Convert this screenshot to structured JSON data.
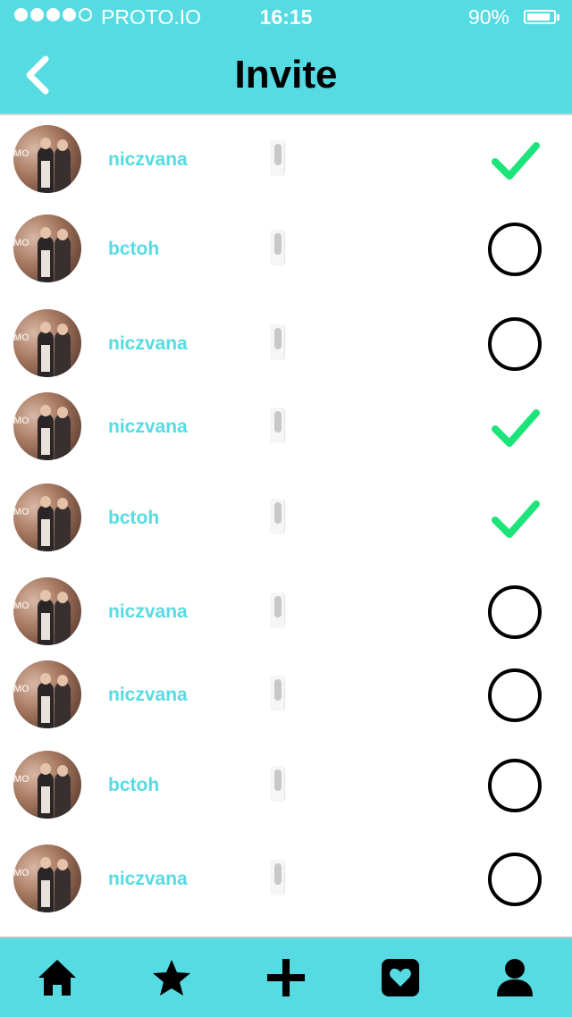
{
  "status_bar": {
    "signal_dots": [
      true,
      true,
      true,
      true,
      false
    ],
    "carrier": "PROTO.IO",
    "time": "16:15",
    "battery": "90%",
    "battery_level": 0.9
  },
  "header": {
    "title": "Invite",
    "back_icon": "chevron-left-icon"
  },
  "colors": {
    "accent": "#56dbe2",
    "check": "#1de47a",
    "text_dark": "#000000"
  },
  "invites": [
    {
      "username": "niczvana",
      "selected": true
    },
    {
      "username": "bctoh",
      "selected": false
    },
    {
      "username": "niczvana",
      "selected": false
    },
    {
      "username": "niczvana",
      "selected": true
    },
    {
      "username": "bctoh",
      "selected": true
    },
    {
      "username": "niczvana",
      "selected": false
    },
    {
      "username": "niczvana",
      "selected": false
    },
    {
      "username": "bctoh",
      "selected": false
    },
    {
      "username": "niczvana",
      "selected": false
    }
  ],
  "avatar_sign_text": "MO",
  "tabbar": {
    "items": [
      {
        "icon": "home-icon"
      },
      {
        "icon": "star-icon"
      },
      {
        "icon": "plus-icon"
      },
      {
        "icon": "heart-box-icon"
      },
      {
        "icon": "person-icon"
      }
    ]
  }
}
